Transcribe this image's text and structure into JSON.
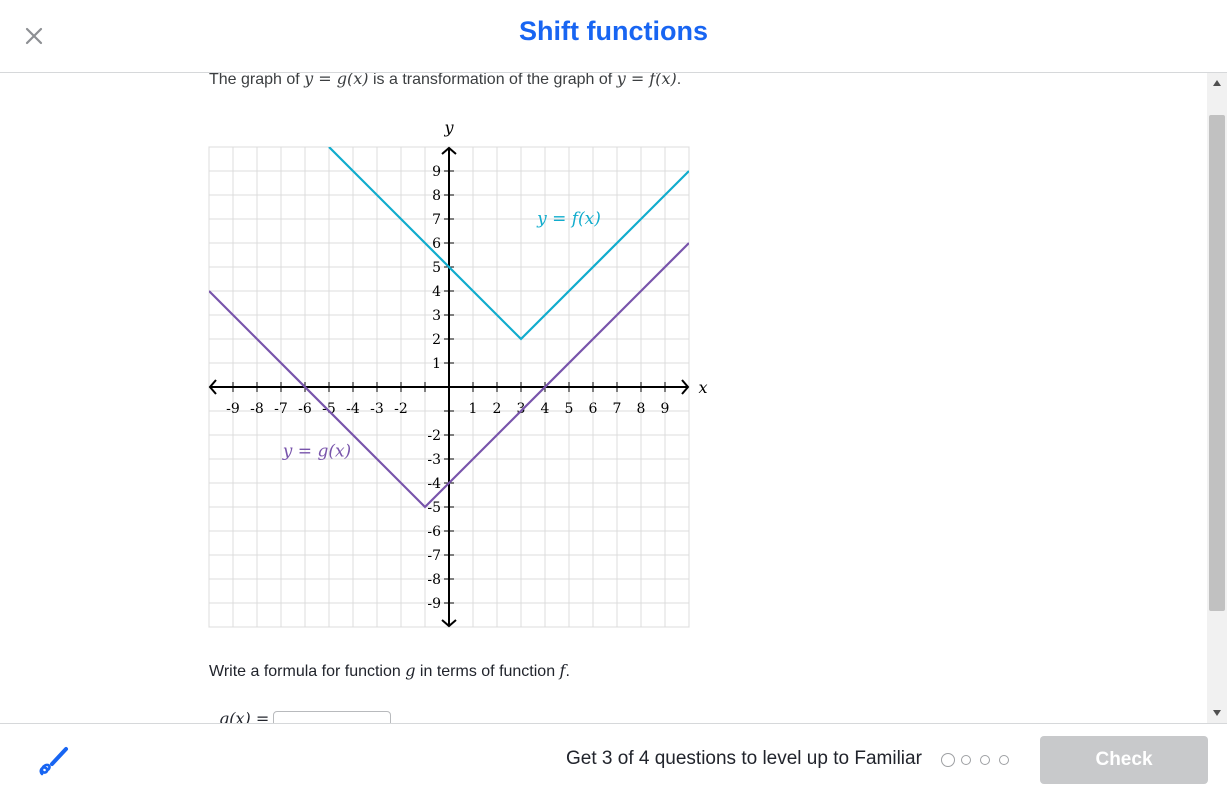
{
  "header": {
    "title": "Shift functions"
  },
  "question": {
    "intro_prefix": "The graph of ",
    "intro_g": "y = g(x)",
    "intro_middle": " is a transformation of the graph of ",
    "intro_f": "y = f(x)",
    "intro_suffix": ".",
    "prompt_prefix": "Write a formula for function ",
    "prompt_g": "g",
    "prompt_middle": " in terms of function ",
    "prompt_f": "f",
    "prompt_suffix": ".",
    "answer_lhs": "g(x) ="
  },
  "chart_data": {
    "type": "line",
    "xlabel": "x",
    "ylabel": "y",
    "xlim": [
      -10,
      10
    ],
    "ylim": [
      -10,
      10
    ],
    "grid": true,
    "x_ticks": [
      "-9",
      "-8",
      "-7",
      "-6",
      "-5",
      "-4",
      "-3",
      "-2",
      "1",
      "2",
      "3",
      "4",
      "5",
      "6",
      "7",
      "8",
      "9"
    ],
    "y_ticks": [
      "9",
      "8",
      "7",
      "6",
      "5",
      "4",
      "3",
      "2",
      "1",
      "-2",
      "-3",
      "-4",
      "-5",
      "-6",
      "-7",
      "-8",
      "-9"
    ],
    "series": [
      {
        "name": "y = f(x)",
        "color": "#11accd",
        "x": [
          -5,
          3,
          10
        ],
        "y": [
          10,
          2,
          9
        ]
      },
      {
        "name": "y = g(x)",
        "color": "#7854ab",
        "x": [
          -10,
          -1,
          10
        ],
        "y": [
          4,
          -5,
          6
        ]
      }
    ]
  },
  "footer": {
    "levelup_text": "Get 3 of 4 questions to level up to Familiar",
    "progress_dots": 4,
    "check_label": "Check"
  },
  "icons": {
    "close": "close-icon",
    "scratchpad": "pencil-icon"
  }
}
